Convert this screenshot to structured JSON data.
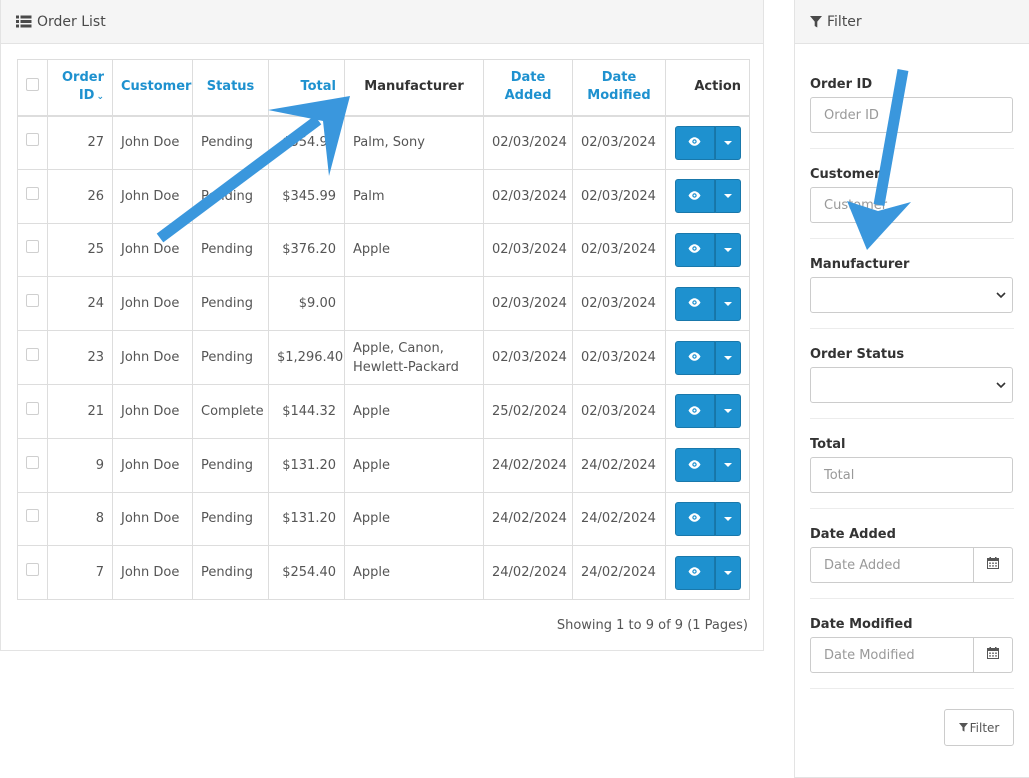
{
  "order_panel": {
    "title": "Order List",
    "columns": {
      "order_id_line1": "Order",
      "order_id_line2": "ID",
      "customer": "Customer",
      "status": "Status",
      "total": "Total",
      "manufacturer": "Manufacturer",
      "date_added_line1": "Date",
      "date_added_line2": "Added",
      "date_modified_line1": "Date",
      "date_modified_line2": "Modified",
      "action": "Action"
    },
    "rows": [
      {
        "id": "27",
        "customer": "John Doe",
        "status": "Pending",
        "total": "$554.99",
        "manufacturer": "Palm, Sony",
        "date_added": "02/03/2024",
        "date_modified": "02/03/2024"
      },
      {
        "id": "26",
        "customer": "John Doe",
        "status": "Pending",
        "total": "$345.99",
        "manufacturer": "Palm",
        "date_added": "02/03/2024",
        "date_modified": "02/03/2024"
      },
      {
        "id": "25",
        "customer": "John Doe",
        "status": "Pending",
        "total": "$376.20",
        "manufacturer": "Apple",
        "date_added": "02/03/2024",
        "date_modified": "02/03/2024"
      },
      {
        "id": "24",
        "customer": "John Doe",
        "status": "Pending",
        "total": "$9.00",
        "manufacturer": "",
        "date_added": "02/03/2024",
        "date_modified": "02/03/2024"
      },
      {
        "id": "23",
        "customer": "John Doe",
        "status": "Pending",
        "total": "$1,296.40",
        "manufacturer": "Apple, Canon, Hewlett-Packard",
        "date_added": "02/03/2024",
        "date_modified": "02/03/2024"
      },
      {
        "id": "21",
        "customer": "John Doe",
        "status": "Complete",
        "total": "$144.32",
        "manufacturer": "Apple",
        "date_added": "25/02/2024",
        "date_modified": "02/03/2024"
      },
      {
        "id": "9",
        "customer": "John Doe",
        "status": "Pending",
        "total": "$131.20",
        "manufacturer": "Apple",
        "date_added": "24/02/2024",
        "date_modified": "24/02/2024"
      },
      {
        "id": "8",
        "customer": "John Doe",
        "status": "Pending",
        "total": "$131.20",
        "manufacturer": "Apple",
        "date_added": "24/02/2024",
        "date_modified": "24/02/2024"
      },
      {
        "id": "7",
        "customer": "John Doe",
        "status": "Pending",
        "total": "$254.40",
        "manufacturer": "Apple",
        "date_added": "24/02/2024",
        "date_modified": "24/02/2024"
      }
    ],
    "pagination_text": "Showing 1 to 9 of 9 (1 Pages)"
  },
  "filter_panel": {
    "title": "Filter",
    "order_id_label": "Order ID",
    "order_id_placeholder": "Order ID",
    "customer_label": "Customer",
    "customer_placeholder": "Customer",
    "manufacturer_label": "Manufacturer",
    "order_status_label": "Order Status",
    "total_label": "Total",
    "total_placeholder": "Total",
    "date_added_label": "Date Added",
    "date_added_placeholder": "Date Added",
    "date_modified_label": "Date Modified",
    "date_modified_placeholder": "Date Modified",
    "filter_button": "Filter"
  },
  "colors": {
    "accent": "#1e91cf",
    "annotation_arrow": "#3a97dd"
  },
  "icons": [
    "list-icon",
    "filter-icon",
    "eye-icon",
    "caret-down-icon",
    "calendar-icon",
    "chevron-down-icon"
  ]
}
